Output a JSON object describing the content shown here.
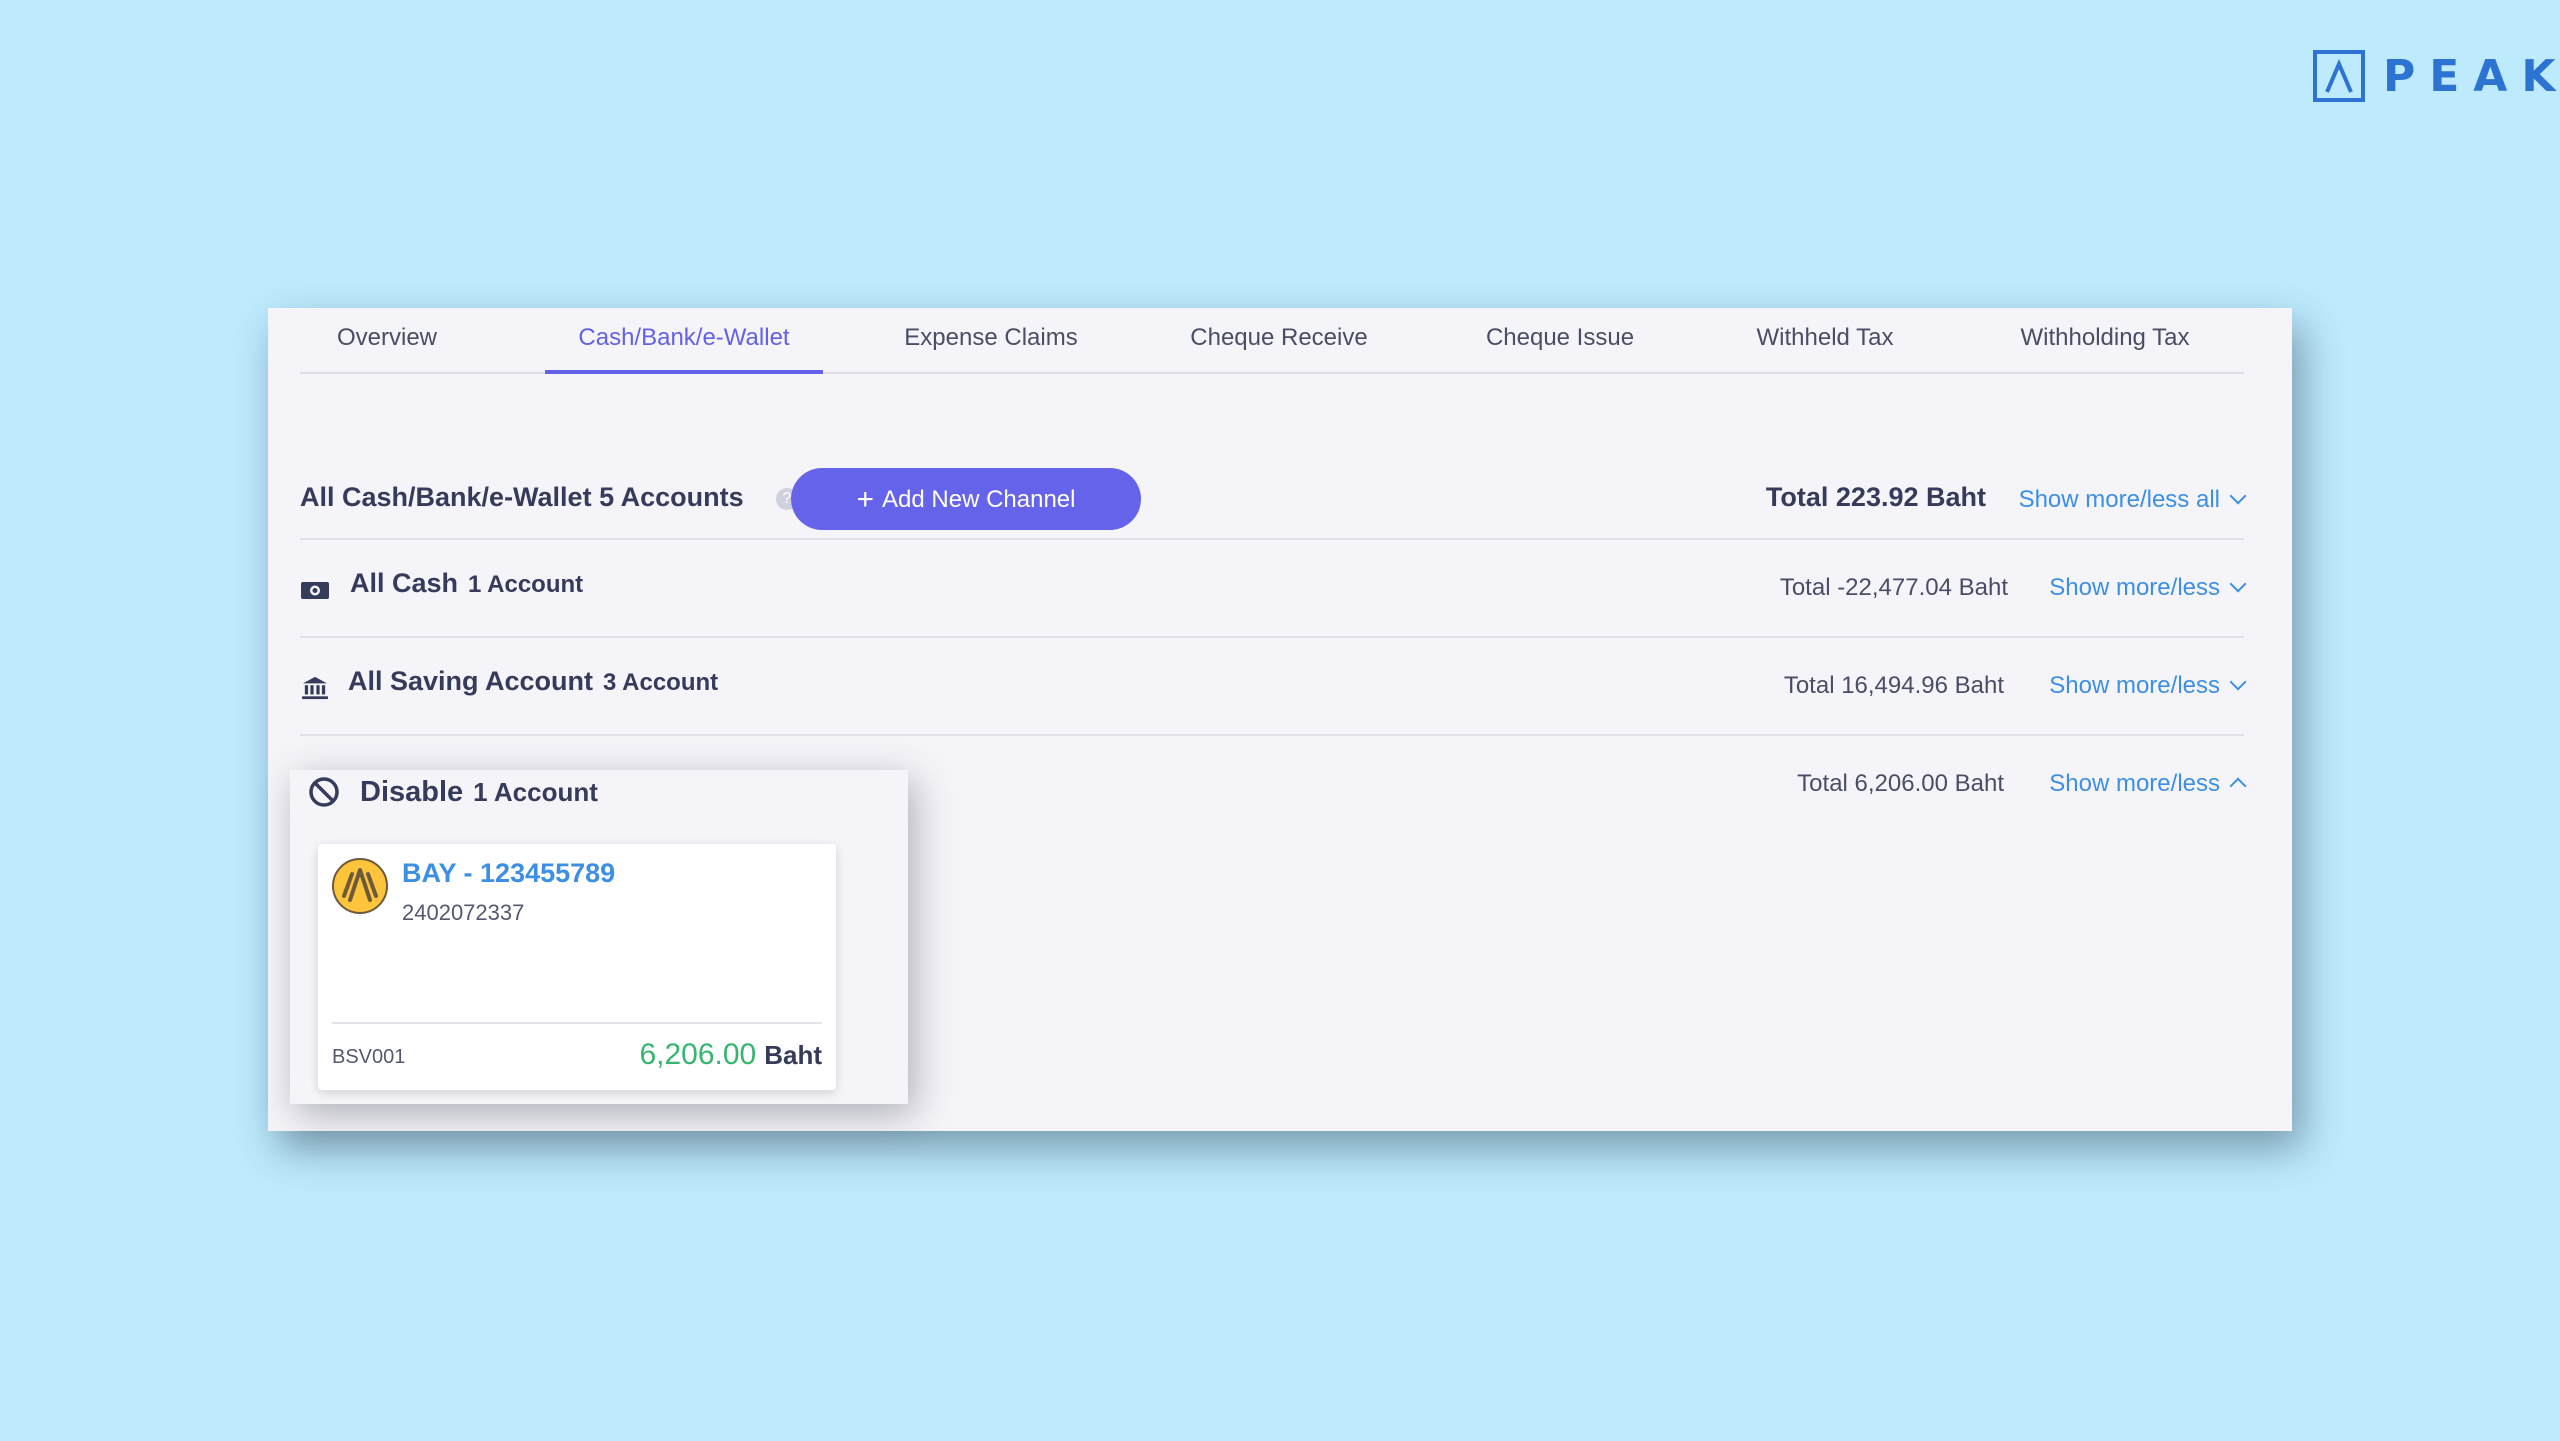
{
  "brand": {
    "logo_text": "PEAK",
    "color": "#2c73d2"
  },
  "tabs": [
    {
      "label": "Overview",
      "active": false
    },
    {
      "label": "Cash/Bank/e-Wallet",
      "active": true
    },
    {
      "label": "Expense Claims",
      "active": false
    },
    {
      "label": "Cheque Receive",
      "active": false
    },
    {
      "label": "Cheque Issue",
      "active": false
    },
    {
      "label": "Withheld Tax",
      "active": false
    },
    {
      "label": "Withholding Tax",
      "active": false
    }
  ],
  "summary": {
    "title": "All Cash/Bank/e-Wallet 5 Accounts",
    "help_icon": "?",
    "add_button": {
      "icon": "+",
      "label": "Add New Channel"
    },
    "total": "Total 223.92 Baht",
    "toggle_all": "Show more/less all"
  },
  "groups": [
    {
      "icon": "cash-icon",
      "name": "All Cash",
      "count": "1 Account",
      "total": "Total -22,477.04 Baht",
      "toggle": "Show more/less",
      "expanded": false
    },
    {
      "icon": "bank-icon",
      "name": "All Saving Account",
      "count": "3 Account",
      "total": "Total 16,494.96 Baht",
      "toggle": "Show more/less",
      "expanded": false
    },
    {
      "icon": "ban-icon",
      "name": "Disable",
      "count": "1 Account",
      "total": "Total 6,206.00 Baht",
      "toggle": "Show more/less",
      "expanded": true
    }
  ],
  "disabled_account": {
    "bank_icon": "krungsri-logo-icon",
    "name": "BAY - 123455789",
    "number": "2402072337",
    "code": "BSV001",
    "amount": "6,206.00",
    "unit": "Baht"
  },
  "colors": {
    "background": "#bdeafd",
    "accent": "#6563ea",
    "link": "#3c8fe4",
    "amount_positive": "#35b66e"
  }
}
